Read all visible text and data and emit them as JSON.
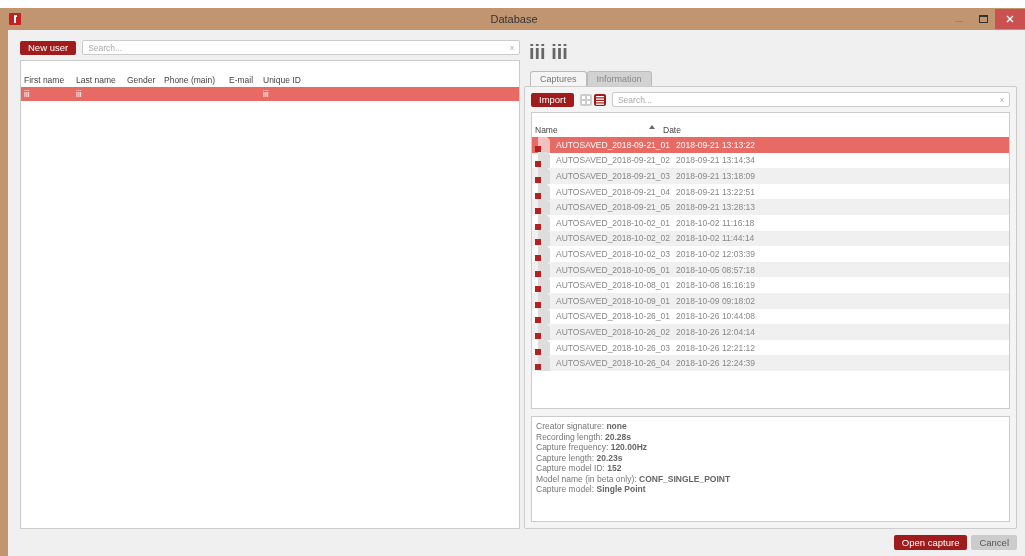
{
  "window": {
    "title": "Database"
  },
  "users": {
    "new_button": "New user",
    "search": {
      "placeholder": "Search...",
      "clear": "x"
    },
    "columns": [
      "First name",
      "Last name",
      "Gender",
      "Phone (main)",
      "E-mail",
      "Unique ID"
    ],
    "rows": [
      {
        "cells": [
          "iii",
          "iii",
          "",
          "",
          "",
          "iii"
        ],
        "selected": true
      }
    ]
  },
  "heading": "iii iii",
  "tabs": [
    {
      "label": "Captures",
      "selected": true
    },
    {
      "label": "Information",
      "selected": false
    }
  ],
  "captures": {
    "import_button": "Import",
    "views": [
      {
        "kind": "grid",
        "selected": false
      },
      {
        "kind": "list",
        "selected": true
      }
    ],
    "search": {
      "placeholder": "Search...",
      "clear": "x"
    },
    "columns": [
      {
        "label": "Name",
        "sorted": true
      },
      {
        "label": "Date",
        "sorted": false
      }
    ],
    "rows": [
      {
        "name": "AUTOSAVED_2018-09-21_01",
        "date": "2018-09-21 13:13:22",
        "selected": true
      },
      {
        "name": "AUTOSAVED_2018-09-21_02",
        "date": "2018-09-21 13:14:34",
        "selected": false
      },
      {
        "name": "AUTOSAVED_2018-09-21_03",
        "date": "2018-09-21 13:18:09",
        "selected": false
      },
      {
        "name": "AUTOSAVED_2018-09-21_04",
        "date": "2018-09-21 13:22:51",
        "selected": false
      },
      {
        "name": "AUTOSAVED_2018-09-21_05",
        "date": "2018-09-21 13:28:13",
        "selected": false
      },
      {
        "name": "AUTOSAVED_2018-10-02_01",
        "date": "2018-10-02 11:16:18",
        "selected": false
      },
      {
        "name": "AUTOSAVED_2018-10-02_02",
        "date": "2018-10-02 11:44:14",
        "selected": false
      },
      {
        "name": "AUTOSAVED_2018-10-02_03",
        "date": "2018-10-02 12:03:39",
        "selected": false
      },
      {
        "name": "AUTOSAVED_2018-10-05_01",
        "date": "2018-10-05 08:57:18",
        "selected": false
      },
      {
        "name": "AUTOSAVED_2018-10-08_01",
        "date": "2018-10-08 16:16:19",
        "selected": false
      },
      {
        "name": "AUTOSAVED_2018-10-09_01",
        "date": "2018-10-09 09:18:02",
        "selected": false
      },
      {
        "name": "AUTOSAVED_2018-10-26_01",
        "date": "2018-10-26 10:44:08",
        "selected": false
      },
      {
        "name": "AUTOSAVED_2018-10-26_02",
        "date": "2018-10-26 12:04:14",
        "selected": false
      },
      {
        "name": "AUTOSAVED_2018-10-26_03",
        "date": "2018-10-26 12:21:12",
        "selected": false
      },
      {
        "name": "AUTOSAVED_2018-10-26_04",
        "date": "2018-10-26 12:24:39",
        "selected": false
      }
    ]
  },
  "details": [
    "Creator signature: **none**",
    "Recording length: **20.28s**",
    "Capture frequency: **120.00Hz**",
    "Capture length: **20.23s**",
    "Capture model ID: **152**",
    "Model name (in beta only): **CONF_SINGLE_POINT**",
    "Capture model: **Single Point**"
  ],
  "buttons": [
    {
      "label": "Open capture",
      "kind": "primary"
    },
    {
      "label": "Cancel",
      "kind": "secondary"
    }
  ]
}
